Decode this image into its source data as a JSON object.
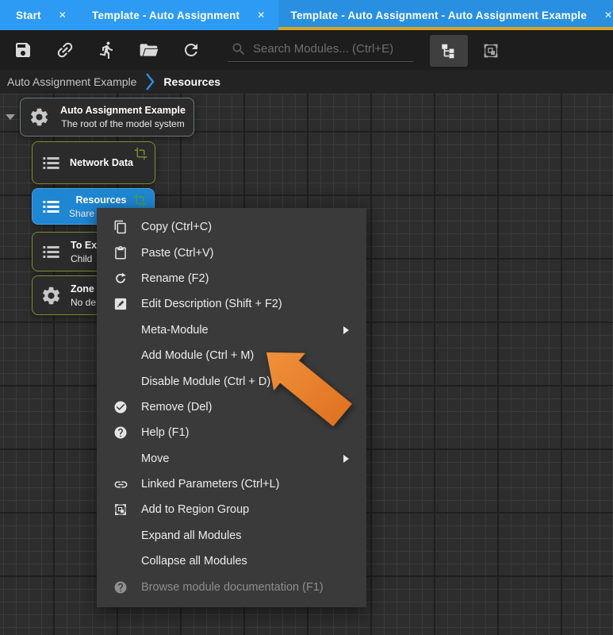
{
  "ui": {
    "close_glyph": "✕"
  },
  "tab_bar": {
    "tabs": [
      {
        "label": "Start",
        "active": false
      },
      {
        "label": "Template - Auto Assignment",
        "active": false
      },
      {
        "label": "Template - Auto Assignment - Auto Assignment Example",
        "active": true
      }
    ]
  },
  "toolbar": {
    "search_placeholder": "Search Modules... (Ctrl+E)",
    "buttons": [
      "save",
      "link",
      "run",
      "open-folder",
      "refresh"
    ],
    "view_buttons": [
      "tree-view",
      "region-group-view"
    ]
  },
  "breadcrumb": {
    "parent": "Auto Assignment Example",
    "current": "Resources"
  },
  "canvas": {
    "modules": {
      "root": {
        "title": "Auto Assignment Example",
        "subtitle": "The root of the model system",
        "icon": "gear-icon"
      },
      "network": {
        "title": "Network Data",
        "icon": "list-icon"
      },
      "resources": {
        "title": "Resources",
        "subtitle": "Share",
        "icon": "list-icon",
        "selected": true
      },
      "to_ex": {
        "title": "To Ex",
        "subtitle": "Child",
        "icon": "list-icon"
      },
      "zone": {
        "title": "Zone",
        "subtitle": "No de",
        "icon": "gear-icon"
      }
    }
  },
  "context_menu": {
    "items": [
      {
        "label": "Copy (Ctrl+C)",
        "icon": "copy-icon"
      },
      {
        "label": "Paste (Ctrl+V)",
        "icon": "paste-icon"
      },
      {
        "label": "Rename (F2)",
        "icon": "rotate-icon"
      },
      {
        "label": "Edit Description (Shift + F2)",
        "icon": "edit-description-icon"
      },
      {
        "label": "Meta-Module",
        "submenu": true
      },
      {
        "label": "Add Module (Ctrl + M)"
      },
      {
        "label": "Disable Module (Ctrl + D)"
      },
      {
        "label": "Remove (Del)",
        "icon": "check-circle-icon"
      },
      {
        "label": "Help (F1)",
        "icon": "help-circle-icon"
      },
      {
        "label": "Move",
        "submenu": true
      },
      {
        "label": "Linked Parameters (Ctrl+L)",
        "icon": "link-icon"
      },
      {
        "label": "Add to Region Group",
        "icon": "region-group-icon"
      },
      {
        "label": "Expand all Modules"
      },
      {
        "label": "Collapse all Modules"
      },
      {
        "label": "Browse module documentation (F1)",
        "icon": "help-circle-icon",
        "disabled": true
      }
    ]
  },
  "annotation_arrow": {
    "color": "#E8802C",
    "points_to": "Add Module (Ctrl + M)"
  },
  "colors": {
    "tab_bar_blue": "#2D9BF3",
    "active_tab_underline": "#D9A422",
    "toolbar_bg": "#1D1D1D",
    "breadcrumb_bg": "#232323",
    "canvas_bg": "#2D2D2D",
    "menu_bg": "#3A3A3A",
    "module_green_border": "#7E8C2F",
    "module_gray_border": "#70777C",
    "selected_module_blue": "#1F86D2",
    "arrow_orange": "#E8802C"
  }
}
